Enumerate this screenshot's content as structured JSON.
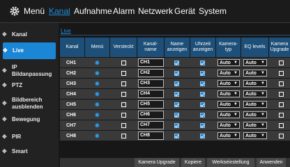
{
  "top_menu": {
    "items": [
      {
        "label": "Menü",
        "active": false
      },
      {
        "label": "Kanal",
        "active": true
      },
      {
        "label": "Aufnahme",
        "active": false
      },
      {
        "label": "Alarm",
        "active": false
      },
      {
        "label": "Netzwerk",
        "active": false
      },
      {
        "label": "Gerät",
        "active": false
      },
      {
        "label": "System",
        "active": false
      }
    ]
  },
  "sidebar": {
    "items": [
      {
        "label": "Kanal",
        "icon": "diamond-icon"
      },
      {
        "label": "Live",
        "icon": "diamond-icon",
        "active": true
      },
      {
        "label": "IP\nBildanpassung",
        "icon": "diamond-icon"
      },
      {
        "label": "PTZ",
        "icon": "diamond-icon"
      },
      {
        "label": "Bildbereich\nausblenden",
        "icon": "diamond-icon"
      },
      {
        "label": "Bewegung",
        "icon": "diamond-icon"
      },
      {
        "label": "PIR",
        "icon": "diamond-icon"
      },
      {
        "label": "Smart",
        "icon": "diamond-icon"
      }
    ]
  },
  "subtab": "Live",
  "table": {
    "headers": [
      "Kanal",
      "Menü",
      "Versteckt",
      "Kanal-\nname",
      "Name\nanzeigen",
      "Uhrzeit\nanzeigen",
      "Kamera-\ntyp",
      "EQ levels",
      "Kamera\nUpgrade"
    ],
    "rows": [
      {
        "kanal": "CH1",
        "name": "CH1",
        "versteckt": false,
        "name_anzeigen": true,
        "uhrzeit": true,
        "typ": "Auto",
        "eq": "Auto",
        "upgrade": false
      },
      {
        "kanal": "CH2",
        "name": "CH2",
        "versteckt": false,
        "name_anzeigen": true,
        "uhrzeit": true,
        "typ": "Auto",
        "eq": "Auto",
        "upgrade": false
      },
      {
        "kanal": "CH3",
        "name": "CH3",
        "versteckt": false,
        "name_anzeigen": true,
        "uhrzeit": true,
        "typ": "Auto",
        "eq": "Auto",
        "upgrade": false
      },
      {
        "kanal": "CH4",
        "name": "CH4",
        "versteckt": false,
        "name_anzeigen": true,
        "uhrzeit": true,
        "typ": "Auto",
        "eq": "Auto",
        "upgrade": false
      },
      {
        "kanal": "CH5",
        "name": "CH5",
        "versteckt": false,
        "name_anzeigen": true,
        "uhrzeit": true,
        "typ": "Auto",
        "eq": "Auto",
        "upgrade": false
      },
      {
        "kanal": "CH6",
        "name": "CH6",
        "versteckt": false,
        "name_anzeigen": true,
        "uhrzeit": true,
        "typ": "Auto",
        "eq": "Auto",
        "upgrade": false
      },
      {
        "kanal": "CH7",
        "name": "CH7",
        "versteckt": false,
        "name_anzeigen": true,
        "uhrzeit": true,
        "typ": "Auto",
        "eq": "Auto",
        "upgrade": false
      },
      {
        "kanal": "CH8",
        "name": "CH8",
        "versteckt": false,
        "name_anzeigen": true,
        "uhrzeit": true,
        "typ": "Auto",
        "eq": "Auto",
        "upgrade": false
      }
    ]
  },
  "buttons": [
    "Kamera Upgrade",
    "Kopiere",
    "Werkseinstellung",
    "Anwenden"
  ],
  "colors": {
    "accent": "#1c86d6",
    "header_bg": "#1d4f78",
    "row_bg": "#3a3a3a",
    "background": "#1a1a1a"
  }
}
